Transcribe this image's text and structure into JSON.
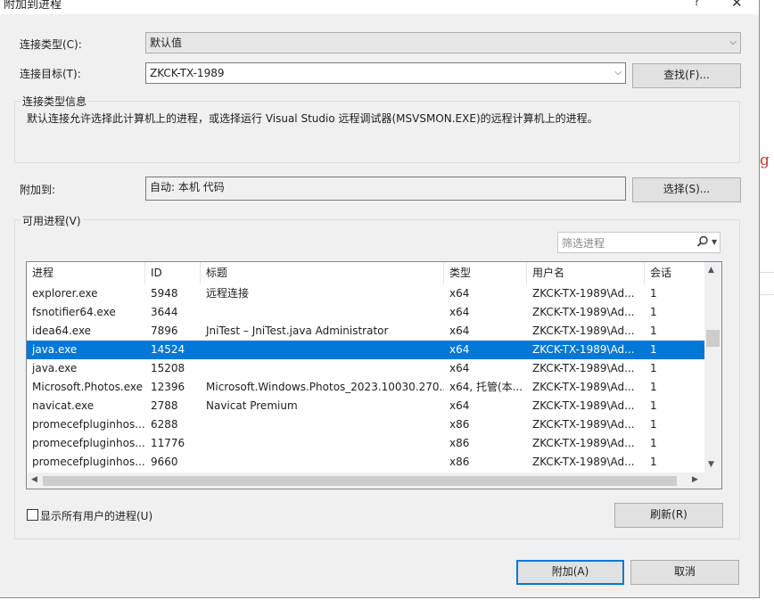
{
  "window": {
    "title": "附加到进程",
    "help": "?",
    "close": "✕"
  },
  "connection_type": {
    "label": "连接类型(C):",
    "value": "默认值"
  },
  "connection_target": {
    "label": "连接目标(T):",
    "value": "ZKCK-TX-1989",
    "find_button": "查找(F)..."
  },
  "connection_info": {
    "caption": "连接类型信息",
    "text": "默认连接允许选择此计算机上的进程，或选择运行 Visual Studio 远程调试器(MSVSMON.EXE)的远程计算机上的进程。"
  },
  "attach_to": {
    "label": "附加到:",
    "value": "自动: 本机 代码",
    "select_button": "选择(S)..."
  },
  "available": {
    "caption": "可用进程(V)",
    "filter_placeholder": "筛选进程",
    "columns": [
      "进程",
      "ID",
      "标题",
      "类型",
      "用户名",
      "会话"
    ],
    "rows": [
      [
        "explorer.exe",
        "5948",
        "远程连接",
        "x64",
        "ZKCK-TX-1989\\Ad...",
        "1"
      ],
      [
        "fsnotifier64.exe",
        "3644",
        "",
        "x64",
        "ZKCK-TX-1989\\Ad...",
        "1"
      ],
      [
        "idea64.exe",
        "7896",
        "JniTest – JniTest.java Administrator",
        "x64",
        "ZKCK-TX-1989\\Ad...",
        "1"
      ],
      [
        "java.exe",
        "14524",
        "",
        "x64",
        "ZKCK-TX-1989\\Ad...",
        "1"
      ],
      [
        "java.exe",
        "15208",
        "",
        "x64",
        "ZKCK-TX-1989\\Ad...",
        "1"
      ],
      [
        "Microsoft.Photos.exe",
        "12396",
        "Microsoft.Windows.Photos_2023.10030.270...",
        "x64, 托管(本...",
        "ZKCK-TX-1989\\Ad...",
        "1"
      ],
      [
        "navicat.exe",
        "2788",
        "Navicat Premium",
        "x64",
        "ZKCK-TX-1989\\Ad...",
        "1"
      ],
      [
        "promecefpluginhos...",
        "6288",
        "",
        "x86",
        "ZKCK-TX-1989\\Ad...",
        "1"
      ],
      [
        "promecefpluginhos...",
        "11776",
        "",
        "x86",
        "ZKCK-TX-1989\\Ad...",
        "1"
      ],
      [
        "promecefpluginhos...",
        "9660",
        "",
        "x86",
        "ZKCK-TX-1989\\Ad...",
        "1"
      ]
    ],
    "selected_row": 3,
    "show_all_users_label": "显示所有用户的进程(U)",
    "show_all_users_checked": false,
    "refresh_button": "刷新(R)"
  },
  "footer": {
    "attach_button": "附加(A)",
    "cancel_button": "取消"
  },
  "background_fragment": "g",
  "colors": {
    "selection": "#0078d7",
    "default_button_border": "#0078d7",
    "dialog_bg": "#f0f0f0"
  },
  "icons": {
    "filter_search": "search-icon",
    "dropdown": "chevron-down-icon"
  }
}
